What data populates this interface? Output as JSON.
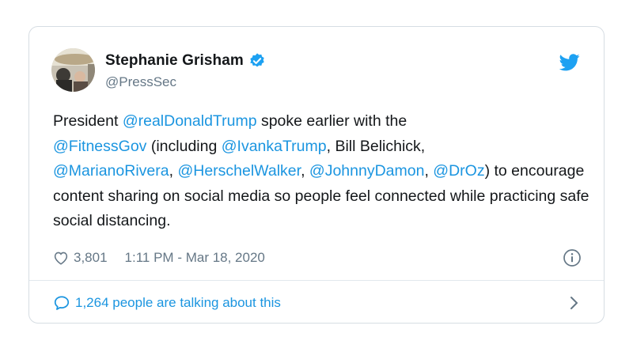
{
  "author": {
    "name": "Stephanie Grisham",
    "handle": "@PressSec",
    "verified": true
  },
  "tweet": {
    "segments": [
      {
        "text": "President ",
        "type": "text"
      },
      {
        "text": "@realDonaldTrump",
        "type": "mention"
      },
      {
        "text": " spoke earlier with the ",
        "type": "text"
      },
      {
        "text": "@FitnessGov",
        "type": "mention"
      },
      {
        "text": " (including ",
        "type": "text"
      },
      {
        "text": "@IvankaTrump",
        "type": "mention"
      },
      {
        "text": ", Bill Belichick, ",
        "type": "text"
      },
      {
        "text": "@MarianoRivera",
        "type": "mention"
      },
      {
        "text": ", ",
        "type": "text"
      },
      {
        "text": "@HerschelWalker",
        "type": "mention"
      },
      {
        "text": ", ",
        "type": "text"
      },
      {
        "text": "@JohnnyDamon",
        "type": "mention"
      },
      {
        "text": ", ",
        "type": "text"
      },
      {
        "text": "@DrOz",
        "type": "mention"
      },
      {
        "text": ") to encourage content sharing on social media so people feel connected while practicing safe social distancing.",
        "type": "text"
      }
    ]
  },
  "meta": {
    "likes": "3,801",
    "timestamp": "1:11 PM - Mar 18, 2020"
  },
  "footer": {
    "talking_label": "1,264 people are talking about this"
  },
  "icons": {
    "brand": "twitter-bird-icon",
    "verified": "verified-badge-icon",
    "like": "heart-icon",
    "info": "info-icon",
    "reply": "speech-bubble-icon",
    "chevron": "chevron-right-icon"
  },
  "colors": {
    "accent": "#1da1f2",
    "mention": "#1b95e0",
    "text": "#14171a",
    "muted": "#657786"
  }
}
